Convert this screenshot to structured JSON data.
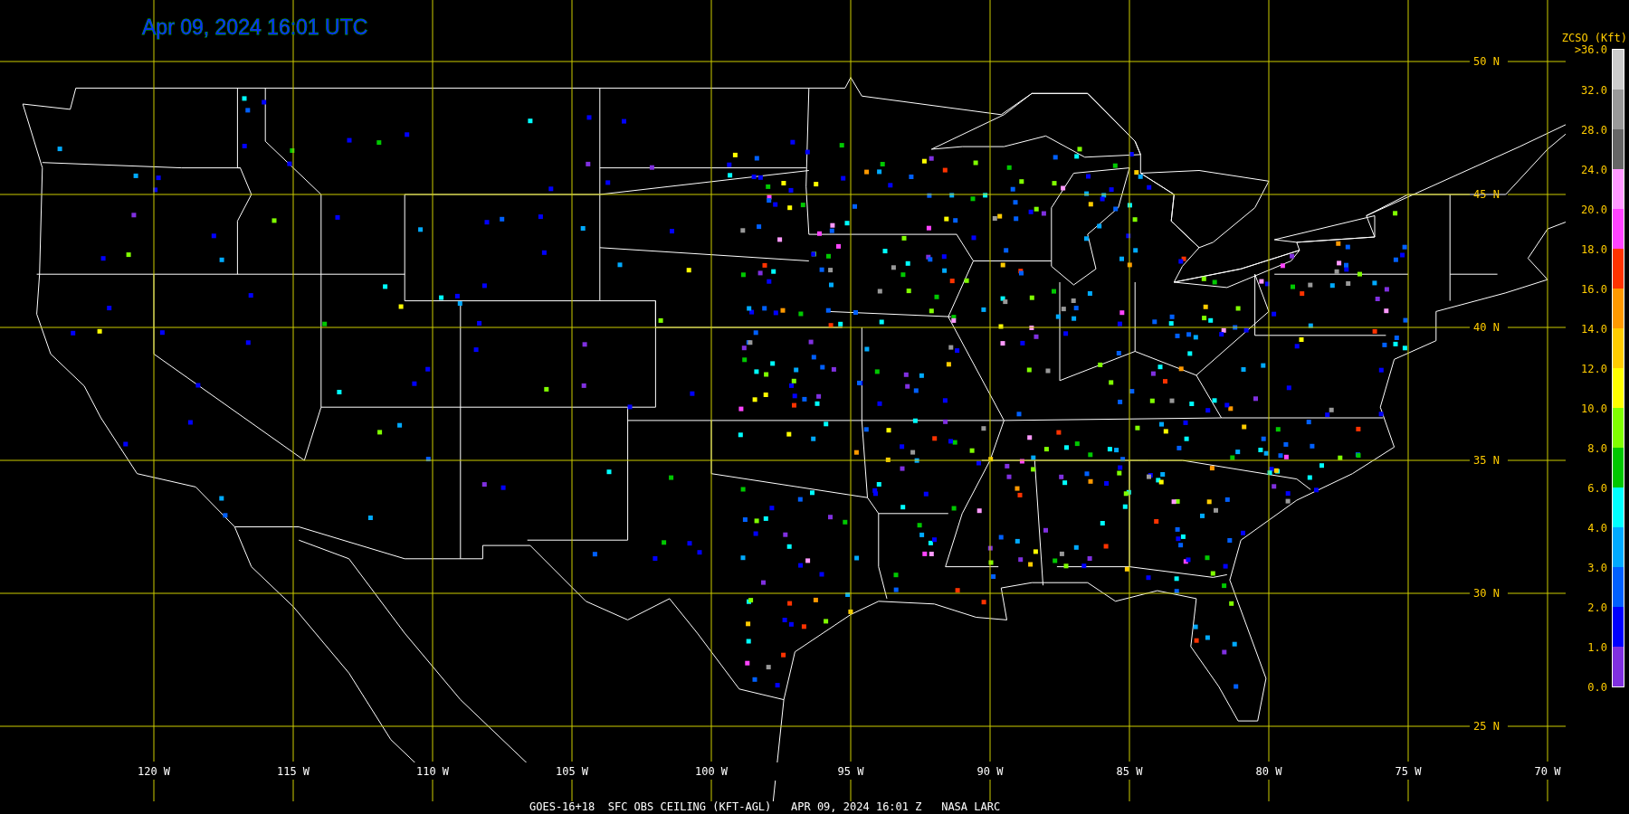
{
  "title": "Apr 09, 2024 16:01 UTC",
  "map": {
    "latitude_labels": [
      "50 N",
      "45 N",
      "40 N",
      "35 N",
      "30 N",
      "25 N"
    ],
    "longitude_labels": [
      "120 W",
      "115 W",
      "110 W",
      "105 W",
      "100 W",
      "95 W",
      "90 W",
      "85 W",
      "80 W",
      "75 W",
      "70 W"
    ]
  },
  "legend": {
    "title": "ZCSO (Kft)",
    "ticks": [
      ">36.0",
      "32.0",
      "28.0",
      "24.0",
      "20.0",
      "18.0",
      "16.0",
      "14.0",
      "12.0",
      "10.0",
      "8.0",
      "6.0",
      "4.0",
      "3.0",
      "2.0",
      "1.0",
      "0.0"
    ],
    "bins": [
      {
        "color": "#cccccc"
      },
      {
        "color": "#999999"
      },
      {
        "color": "#666666"
      },
      {
        "color": "#ff99ff"
      },
      {
        "color": "#ff44ff"
      },
      {
        "color": "#ff3300"
      },
      {
        "color": "#ff9900"
      },
      {
        "color": "#ffcc00"
      },
      {
        "color": "#ffff00"
      },
      {
        "color": "#80ff00"
      },
      {
        "color": "#00c800"
      },
      {
        "color": "#00ffff"
      },
      {
        "color": "#00aaff"
      },
      {
        "color": "#0060ff"
      },
      {
        "color": "#0000ff"
      },
      {
        "color": "#8030e0"
      }
    ]
  },
  "caption": "GOES-16+18  SFC OBS CEILING (KFT-AGL)   APR 09, 2024 16:01 Z   NASA LARC"
}
